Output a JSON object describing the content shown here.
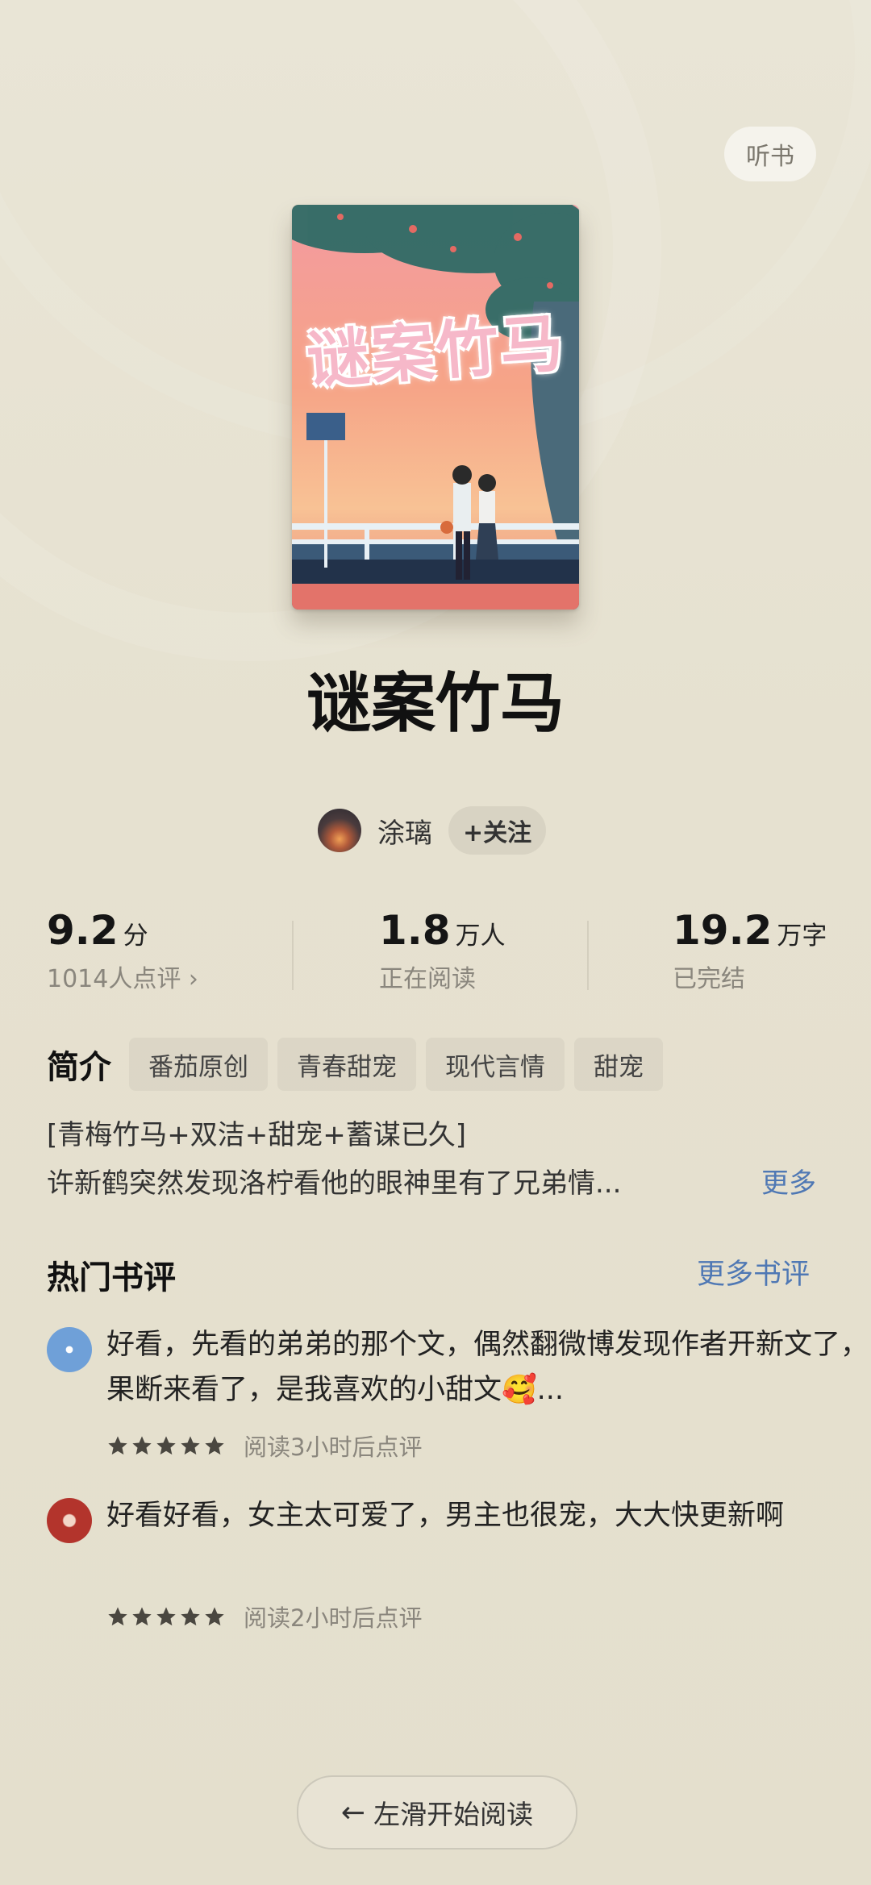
{
  "header": {
    "listen_label": "听书"
  },
  "book": {
    "cover_title": "谜案竹马",
    "title": "谜案竹马"
  },
  "author": {
    "name": "涂璃",
    "follow_label": "+关注"
  },
  "stats": {
    "rating": {
      "value": "9.2",
      "unit": "分",
      "sub": "1014人点评 ›"
    },
    "readers": {
      "value": "1.8",
      "unit": "万人",
      "sub": "正在阅读"
    },
    "words": {
      "value": "19.2",
      "unit": "万字",
      "sub": "已完结"
    }
  },
  "intro": {
    "label": "简介",
    "tags": [
      "番茄原创",
      "青春甜宠",
      "现代言情",
      "甜宠"
    ],
    "line1": "[青梅竹马+双洁+甜宠+蓄谋已久]",
    "line2": "许新鹤突然发现洛柠看他的眼神里有了兄弟情...",
    "more_label": "更多"
  },
  "reviews": {
    "title": "热门书评",
    "more_label": "更多书评",
    "items": [
      {
        "text": "好看，先看的弟弟的那个文，偶然翻微博发现作者开新文了，果断来看了，是我喜欢的小甜文🥰...",
        "stars": 5,
        "meta": "阅读3小时后点评"
      },
      {
        "text": "好看好看，女主太可爱了，男主也很宠，大大快更新啊",
        "stars": 5,
        "meta": "阅读2小时后点评"
      }
    ]
  },
  "footer": {
    "start_label": "左滑开始阅读"
  }
}
